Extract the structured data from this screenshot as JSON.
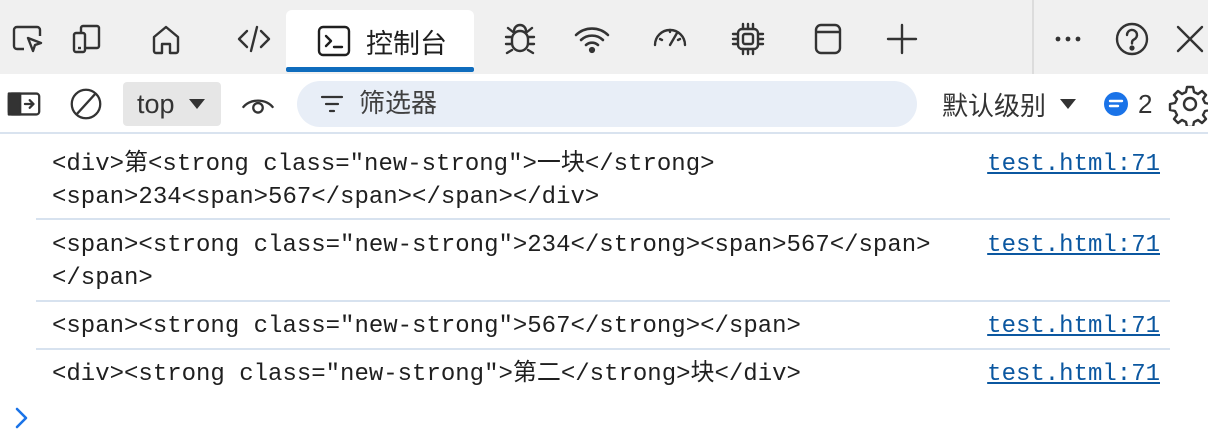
{
  "tabs": [
    {
      "name": "inspect-element",
      "icon": "inspect-icon"
    },
    {
      "name": "device-emulation",
      "icon": "device-icon"
    },
    {
      "name": "welcome",
      "icon": "home-icon"
    },
    {
      "name": "elements",
      "icon": "code-icon"
    },
    {
      "name": "console",
      "icon": "console-icon",
      "label": "控制台",
      "active": true
    },
    {
      "name": "sources",
      "icon": "bug-icon"
    },
    {
      "name": "network",
      "icon": "wifi-icon"
    },
    {
      "name": "performance",
      "icon": "gauge-icon"
    },
    {
      "name": "memory",
      "icon": "chip-icon"
    },
    {
      "name": "application",
      "icon": "window-icon"
    },
    {
      "name": "more-tools",
      "icon": "plus-icon"
    }
  ],
  "console_tab": {
    "label": "控制台"
  },
  "toolbar": {
    "context": "top",
    "filter_placeholder": "筛选器",
    "levels": "默认级别",
    "message_count": "2"
  },
  "colors": {
    "accent": "#0f6cbd",
    "link": "#0b57a0",
    "tabbar_bg": "#f0f0f0",
    "filter_bg": "#e8eef7"
  },
  "log": [
    {
      "line1": "<div>第<strong class=\"new-strong\">一块</strong>",
      "line2": "<span>234<span>567</span></span></div>",
      "source": "test.html:71"
    },
    {
      "line1": "<span><strong class=\"new-strong\">234</strong><span>567</span>",
      "line2": "</span>",
      "source": "test.html:71"
    },
    {
      "line1": "<span><strong class=\"new-strong\">567</strong></span>",
      "source": "test.html:71"
    },
    {
      "line1": "<div><strong class=\"new-strong\">第二</strong>块</div>",
      "source": "test.html:71"
    }
  ]
}
